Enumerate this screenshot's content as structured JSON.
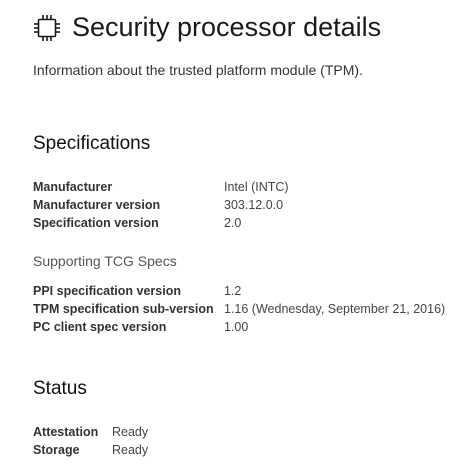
{
  "header": {
    "icon": "processor-chip-icon",
    "title": "Security processor details",
    "subtitle": "Information about the trusted platform module (TPM)."
  },
  "specifications": {
    "title": "Specifications",
    "rows": [
      {
        "label": "Manufacturer",
        "value": "Intel (INTC)"
      },
      {
        "label": "Manufacturer version",
        "value": "303.12.0.0"
      },
      {
        "label": "Specification version",
        "value": "2.0"
      }
    ],
    "tcg": {
      "title": "Supporting TCG Specs",
      "rows": [
        {
          "label": "PPI specification version",
          "value": "1.2"
        },
        {
          "label": "TPM specification sub-version",
          "value": "1.16 (Wednesday, September 21, 2016)"
        },
        {
          "label": "PC client spec version",
          "value": "1.00"
        }
      ]
    }
  },
  "status": {
    "title": "Status",
    "rows": [
      {
        "label": "Attestation",
        "value": "Ready"
      },
      {
        "label": "Storage",
        "value": "Ready"
      }
    ]
  }
}
